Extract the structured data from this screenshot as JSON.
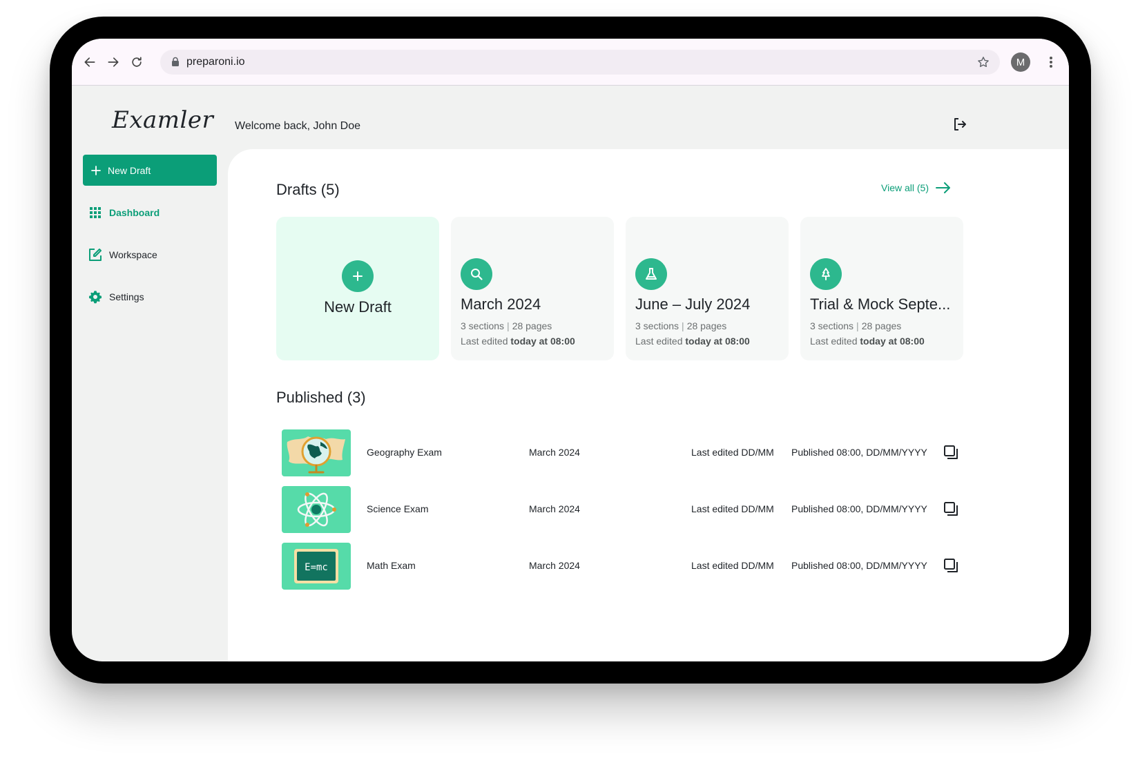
{
  "browser": {
    "url": "preparoni.io",
    "profile_initial": "M"
  },
  "app": {
    "logo": "Examler",
    "welcome": "Welcome back, John Doe"
  },
  "sidebar": {
    "new_draft_label": "New Draft",
    "items": [
      {
        "label": "Dashboard",
        "icon": "grid-icon",
        "active": true
      },
      {
        "label": "Workspace",
        "icon": "edit-icon",
        "active": false
      },
      {
        "label": "Settings",
        "icon": "gear-icon",
        "active": false
      }
    ]
  },
  "drafts": {
    "title": "Drafts (5)",
    "view_all": "View all (5)",
    "new_card_label": "New Draft",
    "cards": [
      {
        "title": "March 2024",
        "sections": "3 sections",
        "pages": "28 pages",
        "edited_prefix": "Last edited",
        "edited_time": "today at 08:00",
        "icon": "search-icon"
      },
      {
        "title": "June – July 2024",
        "sections": "3 sections",
        "pages": "28 pages",
        "edited_prefix": "Last edited",
        "edited_time": "today at 08:00",
        "icon": "flask-icon"
      },
      {
        "title": "Trial & Mock Septe...",
        "sections": "3 sections",
        "pages": "28 pages",
        "edited_prefix": "Last edited",
        "edited_time": "today at 08:00",
        "icon": "tree-icon"
      }
    ]
  },
  "published": {
    "title": "Published (3)",
    "rows": [
      {
        "name": "Geography Exam",
        "term": "March 2024",
        "edited": "Last edited DD/MM",
        "published": "Published 08:00, DD/MM/YYYY",
        "thumb": "globe-icon"
      },
      {
        "name": "Science Exam",
        "term": "March 2024",
        "edited": "Last edited DD/MM",
        "published": "Published 08:00, DD/MM/YYYY",
        "thumb": "atom-icon"
      },
      {
        "name": "Math Exam",
        "term": "March 2024",
        "edited": "Last edited DD/MM",
        "published": "Published 08:00, DD/MM/YYYY",
        "thumb": "chalkboard-icon",
        "thumb_text": "E=mc"
      }
    ]
  },
  "colors": {
    "accent": "#0b9e78",
    "accent_circle": "#2db88e",
    "thumb_bg": "#56dba9",
    "new_card_bg": "#e6fcf2"
  }
}
